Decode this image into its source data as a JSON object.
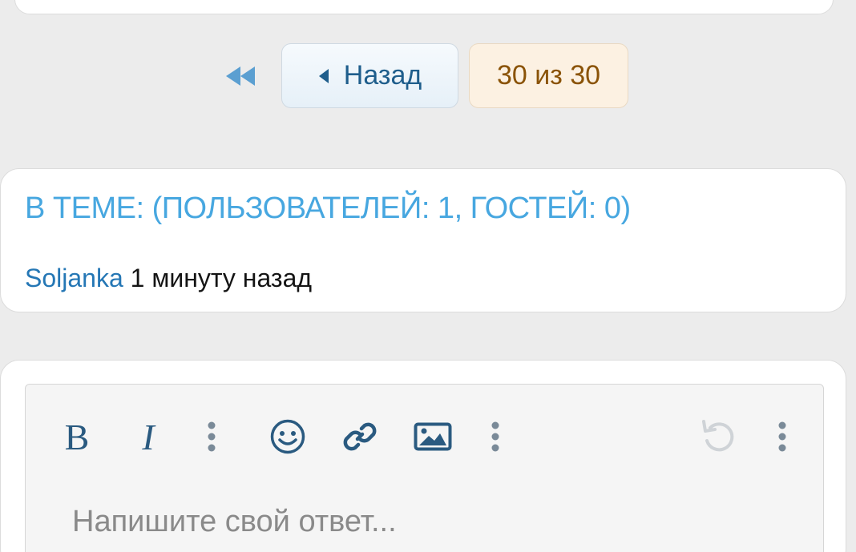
{
  "pagination": {
    "first_icon": "double-chevron-left-icon",
    "prev_icon": "caret-left-icon",
    "prev_label": "Назад",
    "count_label": "30 из 30"
  },
  "users_in_topic": {
    "title": "В ТЕМЕ: (ПОЛЬЗОВАТЕЛЕЙ: 1, ГОСТЕЙ: 0)",
    "users": [
      {
        "name": "Soljanka",
        "time": "1 минуту назад"
      }
    ]
  },
  "reply_editor": {
    "toolbar": {
      "bold_label": "B",
      "italic_label": "I",
      "icons": [
        "more-vertical-icon",
        "smiley-icon",
        "link-icon",
        "image-icon",
        "more-vertical-icon",
        "undo-icon",
        "more-vertical-icon"
      ]
    },
    "placeholder": "Напишите свой ответ..."
  },
  "colors": {
    "accent": "#47a7e0",
    "link": "#2577b5",
    "toolbar_icon": "#2a5a80",
    "count_text": "#8a5307",
    "count_bg": "#fcf1e2"
  }
}
